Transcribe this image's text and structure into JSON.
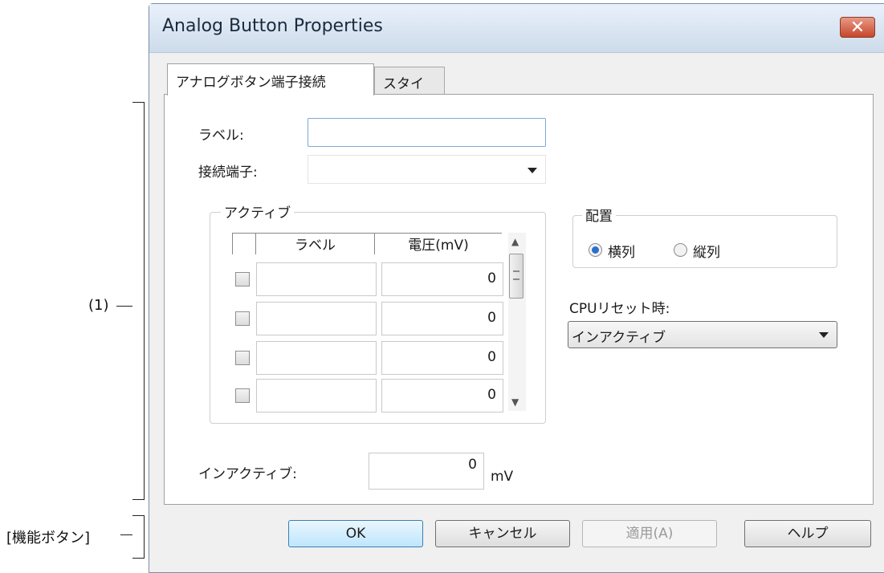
{
  "annotations": {
    "region1_label": "(1)",
    "function_buttons_label": "[機能ボタン]"
  },
  "dialog": {
    "title": "Analog Button Properties",
    "close_glyph": "✕"
  },
  "tabs": [
    {
      "label": "アナログボタン端子接続",
      "active": true
    },
    {
      "label": "スタイル",
      "active": false
    }
  ],
  "form": {
    "label_caption": "ラベル:",
    "label_value": "",
    "terminal_caption": "接続端子:",
    "terminal_value": ""
  },
  "active_group": {
    "caption": "アクティブ",
    "columns": [
      "",
      "ラベル",
      "電圧(mV)"
    ],
    "rows": [
      {
        "checked": false,
        "label": "",
        "voltage": "0"
      },
      {
        "checked": false,
        "label": "",
        "voltage": "0"
      },
      {
        "checked": false,
        "label": "",
        "voltage": "0"
      },
      {
        "checked": false,
        "label": "",
        "voltage": "0"
      }
    ],
    "scroll_up": "▲",
    "scroll_down": "▼"
  },
  "layout_group": {
    "caption": "配置",
    "options": [
      {
        "label": "横列",
        "selected": true
      },
      {
        "label": "縦列",
        "selected": false
      }
    ]
  },
  "cpu_reset": {
    "caption": "CPUリセット時:",
    "value": "インアクティブ"
  },
  "inactive": {
    "caption": "インアクティブ:",
    "value": "0",
    "unit": "mV"
  },
  "buttons": {
    "ok": "OK",
    "cancel": "キャンセル",
    "apply": "適用(A)",
    "help": "ヘルプ"
  }
}
